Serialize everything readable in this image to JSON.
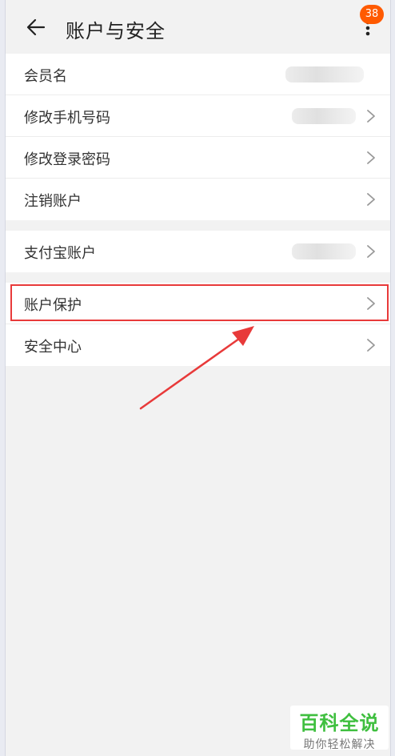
{
  "header": {
    "title": "账户与安全",
    "badge": "38",
    "back_icon": "arrow-left-icon",
    "more_icon": "more-vertical-icon"
  },
  "group1": [
    {
      "label": "会员名"
    },
    {
      "label": "修改手机号码"
    },
    {
      "label": "修改登录密码"
    },
    {
      "label": "注销账户"
    }
  ],
  "group2": [
    {
      "label": "支付宝账户"
    }
  ],
  "group3": [
    {
      "label": "账户保护"
    },
    {
      "label": "安全中心"
    }
  ],
  "annotation": {
    "color": "#e83a3a"
  },
  "watermark": {
    "title": "百科全说",
    "subtitle": "助你轻松解决"
  },
  "colors": {
    "badge": "#ff5a00",
    "watermark_green": "#3fbf3f"
  }
}
